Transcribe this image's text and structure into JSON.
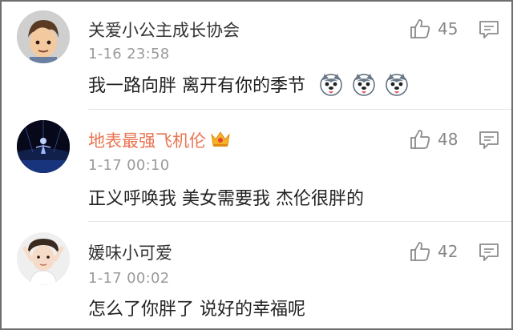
{
  "comments": [
    {
      "username": "关爱小公主成长协会",
      "timestamp": "1-16 23:58",
      "text": "我一路向胖 离开有你的季节",
      "emoji_icon": "husky-dog-face-icon",
      "emoji_count": 3,
      "likes": "45",
      "vip": false
    },
    {
      "username": "地表最强飞机伦",
      "timestamp": "1-17 00:10",
      "text": "正义呼唤我 美女需要我 杰伦很胖的",
      "likes": "48",
      "vip": true
    },
    {
      "username": "媛味小可爱",
      "timestamp": "1-17 00:02",
      "text": "怎么了你胖了 说好的幸福呢",
      "likes": "42",
      "vip": false
    }
  ],
  "colors": {
    "vip_username": "#eb7350",
    "username": "#333333",
    "timestamp": "#9a9a9a",
    "icon": "#8a8a8a"
  }
}
